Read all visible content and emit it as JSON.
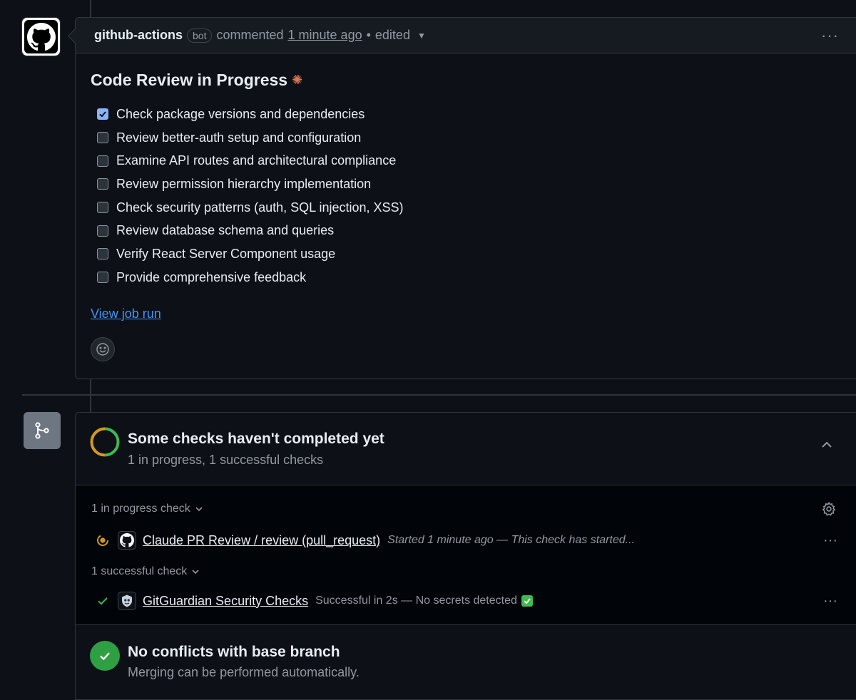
{
  "comment": {
    "author": "github-actions",
    "badge": "bot",
    "action": "commented",
    "time": "1 minute ago",
    "separator": "•",
    "edited": "edited",
    "title": "Code Review in Progress",
    "title_icon": "sparkle-icon",
    "tasks": [
      {
        "label": "Check package versions and dependencies",
        "checked": true
      },
      {
        "label": "Review better-auth setup and configuration",
        "checked": false
      },
      {
        "label": "Examine API routes and architectural compliance",
        "checked": false
      },
      {
        "label": "Review permission hierarchy implementation",
        "checked": false
      },
      {
        "label": "Check security patterns (auth, SQL injection, XSS)",
        "checked": false
      },
      {
        "label": "Review database schema and queries",
        "checked": false
      },
      {
        "label": "Verify React Server Component usage",
        "checked": false
      },
      {
        "label": "Provide comprehensive feedback",
        "checked": false
      }
    ],
    "link": "View job run"
  },
  "checks": {
    "title": "Some checks haven't completed yet",
    "subtitle": "1 in progress, 1 successful checks",
    "in_progress_label": "1 in progress check",
    "successful_label": "1 successful check",
    "in_progress": {
      "name": "Claude PR Review / review (pull_request)",
      "description": "Started 1 minute ago — This check has started..."
    },
    "successful": {
      "name": "GitGuardian Security Checks",
      "description": "Successful in 2s — No secrets detected"
    }
  },
  "merge": {
    "title": "No conflicts with base branch",
    "subtitle": "Merging can be performed automatically."
  },
  "colors": {
    "background": "#0d1117",
    "link": "#4493f8",
    "success": "#2ea043",
    "pending": "#d29922",
    "sparkle": "#d97757"
  }
}
